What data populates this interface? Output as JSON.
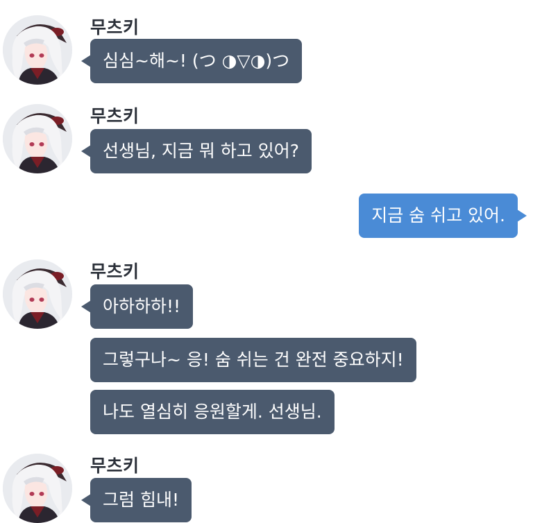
{
  "contact": {
    "name": "무츠키"
  },
  "messages": [
    {
      "text": "심심~해~! (つ ◑▽◑)つ"
    },
    {
      "text": "선생님, 지금 뭐 하고 있어?"
    },
    {
      "text": "지금 숨 쉬고 있어."
    },
    {
      "text": "아하하하!!"
    },
    {
      "text": "그렇구나~ 응! 숨 쉬는 건 완전 중요하지!"
    },
    {
      "text": "나도 열심히 응원할게. 선생님."
    },
    {
      "text": "그럼 힘내!"
    }
  ],
  "icons": {
    "avatar": "avatar-portrait-icon"
  },
  "colors": {
    "incoming_bubble": "#4b5a6e",
    "outgoing_bubble": "#4a8bd6",
    "name_text": "#2a2f38",
    "background": "#ffffff"
  }
}
